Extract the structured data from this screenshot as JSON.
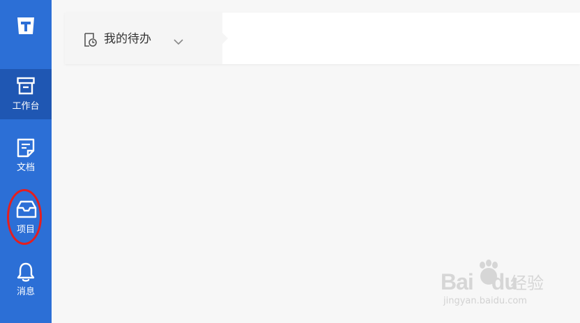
{
  "sidebar": {
    "logo_icon": "app-logo-icon",
    "items": [
      {
        "label": "工作台",
        "icon": "archive-box-icon",
        "active": true
      },
      {
        "label": "文档",
        "icon": "document-icon",
        "active": false
      },
      {
        "label": "项目",
        "icon": "inbox-icon",
        "active": false
      },
      {
        "label": "消息",
        "icon": "bell-icon",
        "active": false
      }
    ]
  },
  "header": {
    "tab": {
      "label": "我的待办",
      "icon": "todo-clock-icon",
      "dropdown_icon": "chevron-down-icon"
    }
  },
  "watermark": {
    "brand_left": "Bai",
    "brand_mid": "du",
    "brand_suffix": "经验",
    "url": "jingyan.baidu.com"
  },
  "colors": {
    "sidebar_bg": "#2c6fd6",
    "sidebar_active_bg": "#1f57b3",
    "annotation": "#e51e1e",
    "content_bg": "#f7f7f7"
  }
}
